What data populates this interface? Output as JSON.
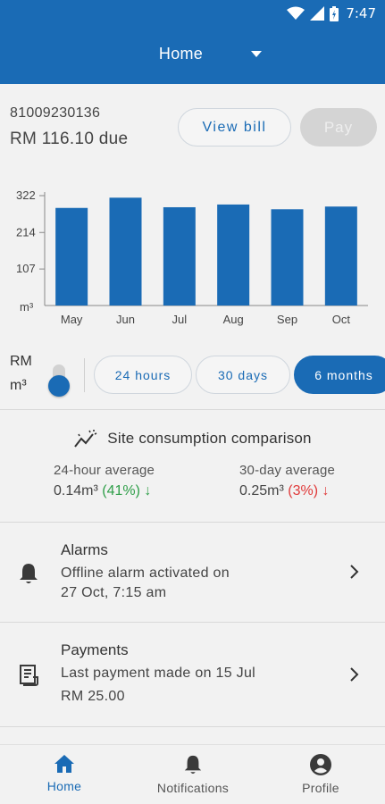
{
  "status_bar": {
    "time": "7:47"
  },
  "header": {
    "title": "Home"
  },
  "account": {
    "number": "81009230136",
    "amount_due": "RM 116.10 due",
    "view_bill_label": "View bill",
    "pay_label": "Pay"
  },
  "chart_data": {
    "type": "bar",
    "categories": [
      "May",
      "Jun",
      "Jul",
      "Aug",
      "Sep",
      "Oct"
    ],
    "values": [
      286,
      316,
      288,
      296,
      282,
      290
    ],
    "ylabel": "m³",
    "yticks": [
      107,
      214,
      322
    ],
    "ylim": [
      0,
      322
    ],
    "color": "#1a6bb5",
    "grid": false
  },
  "units": {
    "rm": "RM",
    "m3": "m³"
  },
  "ranges": [
    {
      "label": "24 hours",
      "active": false
    },
    {
      "label": "30 days",
      "active": false
    },
    {
      "label": "6 months",
      "active": true
    }
  ],
  "comparison": {
    "title": "Site consumption comparison",
    "left": {
      "label": "24-hour average",
      "value": "0.14m³",
      "pct": "(41%)",
      "arrow": "↓",
      "color": "#2e9e48"
    },
    "right": {
      "label": "30-day average",
      "value": "0.25m³",
      "pct": "(3%)",
      "arrow": "↓",
      "color": "#e03a3a"
    }
  },
  "alarms": {
    "title": "Alarms",
    "line1": "Offline alarm activated on",
    "line2": "27 Oct, 7:15 am",
    "icon": "bell-icon"
  },
  "payments": {
    "title": "Payments",
    "line1": "Last payment made on 15 Jul",
    "line2": "RM 25.00",
    "icon": "receipt-icon"
  },
  "nav": [
    {
      "label": "Home",
      "icon": "home-icon",
      "active": true
    },
    {
      "label": "Notifications",
      "icon": "bell-icon",
      "active": false
    },
    {
      "label": "Profile",
      "icon": "user-icon",
      "active": false
    }
  ]
}
